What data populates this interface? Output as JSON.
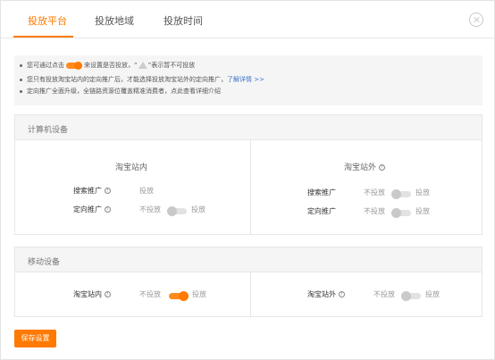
{
  "tabs": [
    {
      "label": "投放平台"
    },
    {
      "label": "投放地域"
    },
    {
      "label": "投放时间"
    }
  ],
  "notice": {
    "line1_prefix": "您可通过点击",
    "line1_mid": "来设置是否投放，“",
    "line1_suffix": "”表示暂不可投放",
    "line2_text": "您只有投放淘宝站内的定向推广后，才能选择投放淘宝站外的定向推广，",
    "line2_link": "了解详情 >>",
    "line3_text": "定向推广全面升级，全链路资源位覆盖精准消费者，点此查看详细介绍"
  },
  "computer": {
    "title": "计算机设备",
    "inside": {
      "title": "淘宝站内",
      "rows": [
        {
          "label": "搜索推广",
          "status": "投放"
        },
        {
          "label": "定向推广",
          "off_label": "不投放",
          "on_label": "投放",
          "state": "off"
        }
      ]
    },
    "outside": {
      "title": "淘宝站外",
      "rows": [
        {
          "label": "搜索推广",
          "off_label": "不投放",
          "on_label": "投放",
          "state": "off"
        },
        {
          "label": "定向推广",
          "off_label": "不投放",
          "on_label": "投放",
          "state": "off"
        }
      ]
    }
  },
  "mobile": {
    "title": "移动设备",
    "inside": {
      "label": "淘宝站内",
      "off_label": "不投放",
      "on_label": "投放",
      "state": "on"
    },
    "outside": {
      "label": "淘宝站外",
      "off_label": "不投放",
      "on_label": "投放",
      "state": "off"
    }
  },
  "save_label": "保存设置",
  "help_glyph": "?",
  "colors": {
    "accent": "#ff7a00",
    "link": "#3a73c9"
  }
}
